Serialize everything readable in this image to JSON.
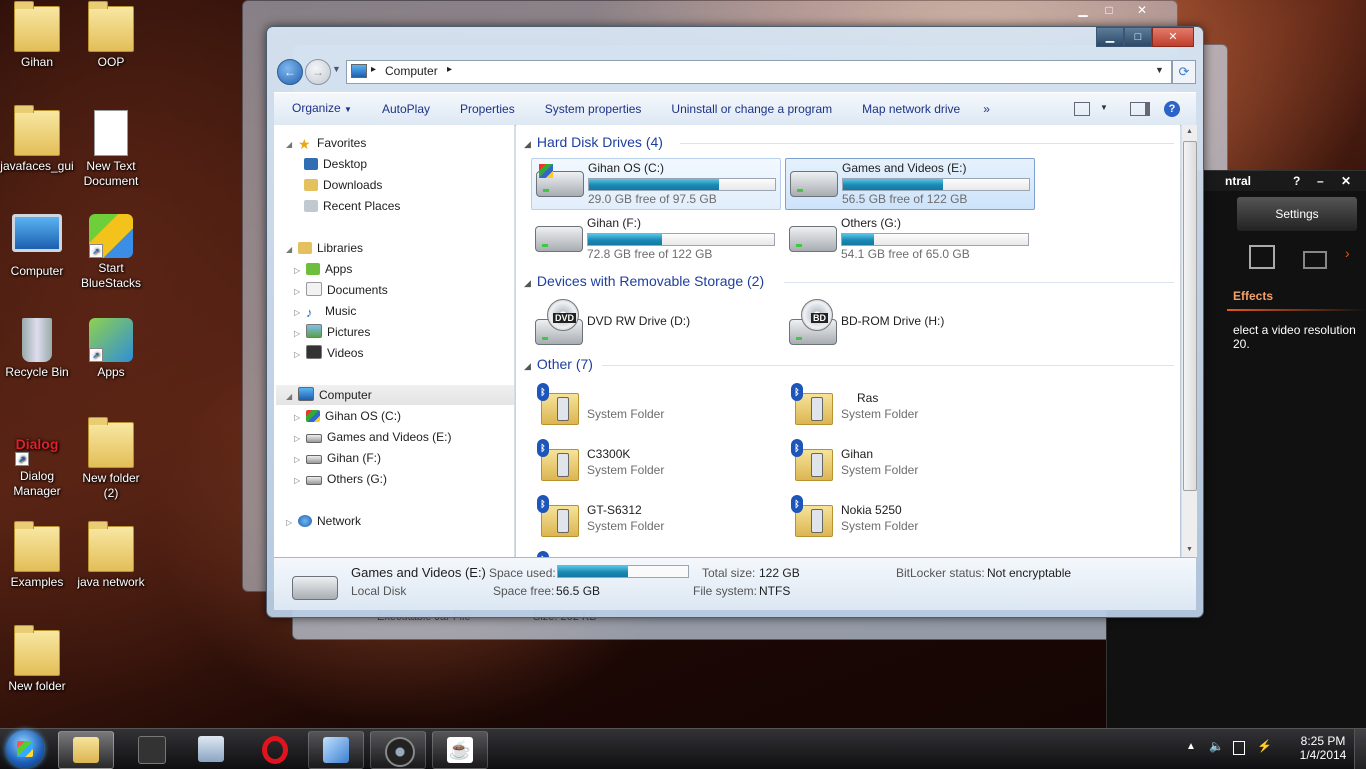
{
  "desktop": {
    "icons": [
      {
        "label": "Gihan"
      },
      {
        "label": "OOP"
      },
      {
        "label": "javafaces_gui"
      },
      {
        "label": "New Text Document"
      },
      {
        "label": "Computer"
      },
      {
        "label": "Start BlueStacks"
      },
      {
        "label": "Recycle Bin"
      },
      {
        "label": "Apps"
      },
      {
        "label": "Dialog Manager"
      },
      {
        "label": "New folder (2)"
      },
      {
        "label": "Examples"
      },
      {
        "label": "java network"
      },
      {
        "label": "New folder"
      }
    ],
    "dialog_logo_text": "Dialog"
  },
  "bg_window": {
    "caption_min": "▁",
    "caption_max": "□",
    "caption_close": "✕",
    "panel_title": "ntral",
    "panel_help": "?",
    "panel_min": "–",
    "panel_close": "✕",
    "settings_label": "Settings",
    "effects_label": "Effects",
    "text_line1": "elect a video resolution",
    "text_line2": "20.",
    "behind_row_text": "Executable Jar File",
    "behind_size_text": "Size: 202 KB"
  },
  "explorer": {
    "title_buttons": {
      "min": "▁",
      "max": "□",
      "close": "✕"
    },
    "address": {
      "root_icon": "computer-icon",
      "crumb": "Computer",
      "sep": "▸"
    },
    "toolbar": {
      "organize": "Organize",
      "autoplay": "AutoPlay",
      "properties": "Properties",
      "system_properties": "System properties",
      "uninstall": "Uninstall or change a program",
      "map_drive": "Map network drive",
      "more": "»",
      "help": "?"
    },
    "nav": {
      "favorites": "Favorites",
      "desktop": "Desktop",
      "downloads": "Downloads",
      "recent": "Recent Places",
      "libraries": "Libraries",
      "apps": "Apps",
      "documents": "Documents",
      "music": "Music",
      "pictures": "Pictures",
      "videos": "Videos",
      "computer": "Computer",
      "drive_c": "Gihan OS (C:)",
      "drive_e": "Games and Videos (E:)",
      "drive_f": "Gihan (F:)",
      "drive_g": "Others (G:)",
      "network": "Network"
    },
    "groups": {
      "hdd": "Hard Disk Drives (4)",
      "removable": "Devices with Removable Storage (2)",
      "other": "Other (7)"
    },
    "drives": [
      {
        "name": "Gihan OS (C:)",
        "free": "29.0 GB free of 97.5 GB",
        "used_fraction": 0.7
      },
      {
        "name": "Games and Videos (E:)",
        "free": "56.5 GB free of 122 GB",
        "used_fraction": 0.54
      },
      {
        "name": "Gihan (F:)",
        "free": "72.8 GB free of 122 GB",
        "used_fraction": 0.4
      },
      {
        "name": "Others (G:)",
        "free": "54.1 GB free of 65.0 GB",
        "used_fraction": 0.17
      }
    ],
    "removable": [
      {
        "name": "DVD RW Drive (D:)",
        "badge": "DVD"
      },
      {
        "name": "BD-ROM Drive (H:)",
        "badge": "BD"
      }
    ],
    "other": [
      {
        "name": "",
        "sub": "System Folder"
      },
      {
        "name": "Ras",
        "sub": "System Folder"
      },
      {
        "name": "C3300K",
        "sub": "System Folder"
      },
      {
        "name": "Gihan",
        "sub": "System Folder"
      },
      {
        "name": "GT-S6312",
        "sub": "System Folder"
      },
      {
        "name": "Nokia 5250",
        "sub": "System Folder"
      }
    ],
    "details": {
      "name": "Games and Videos (E:)",
      "type": "Local Disk",
      "space_used_label": "Space used:",
      "used_fraction": 0.54,
      "total_label": "Total size:",
      "total_value": "122 GB",
      "free_label": "Space free:",
      "free_value": "56.5 GB",
      "fs_label": "File system:",
      "fs_value": "NTFS",
      "bitlocker_label": "BitLocker status:",
      "bitlocker_value": "Not encryptable"
    }
  },
  "taskbar": {
    "time": "8:25 PM",
    "date": "1/4/2014",
    "pinned": [
      "windows-explorer-icon",
      "dizador-icon",
      "calculator-icon",
      "opera-icon",
      "virtualbox-icon",
      "camera-icon",
      "java-icon"
    ]
  },
  "colors": {
    "accent": "#1e3287",
    "group_heading": "#1e3fa0",
    "progress": "#1c89b3"
  }
}
